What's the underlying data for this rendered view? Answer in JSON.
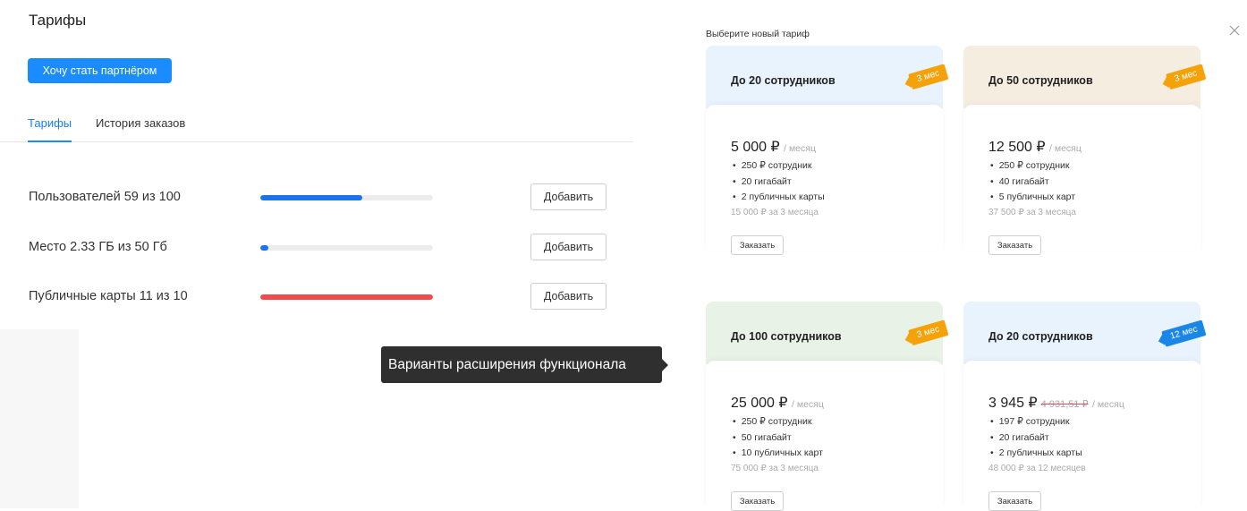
{
  "page": {
    "title": "Тарифы",
    "partner_button": "Хочу стать партнёром",
    "tabs": [
      {
        "label": "Тарифы",
        "active": true
      },
      {
        "label": "История заказов",
        "active": false
      }
    ],
    "tooltip": "Варианты расширения функционала"
  },
  "usage": [
    {
      "label": "Пользователей 59 из 100",
      "fill_fraction": 0.59,
      "color": "#1a73e8",
      "button": "Добавить"
    },
    {
      "label": "Место 2.33 ГБ из 50 Гб",
      "fill_fraction": 0.0466,
      "color": "#1a73e8",
      "button": "Добавить"
    },
    {
      "label": "Публичные карты 11 из 10",
      "fill_fraction": 1.0,
      "color": "#f24b4b",
      "button": "Добавить"
    }
  ],
  "plans_panel": {
    "title": "Выберите новый тариф",
    "close_icon": "close-icon",
    "plans": [
      {
        "name": "До 20 сотрудников",
        "badge": "3 мес",
        "badge_color": "#f5a20a",
        "header_color": "#e8f3fd",
        "price": "5 000 ₽",
        "per": "/ месяц",
        "old_price": "",
        "features": [
          "250 ₽ сотрудник",
          "20 гигабайт",
          "2 публичных карты"
        ],
        "total": "15 000 ₽ за 3 месяца",
        "order": "Заказать"
      },
      {
        "name": "До 50 сотрудников",
        "badge": "3 мес",
        "badge_color": "#f5a20a",
        "header_color": "#f6ede1",
        "price": "12 500 ₽",
        "per": "/ месяц",
        "old_price": "",
        "features": [
          "250 ₽ сотрудник",
          "40 гигабайт",
          "5 публичных карт"
        ],
        "total": "37 500 ₽ за 3 месяца",
        "order": "Заказать"
      },
      {
        "name": "До 100 сотрудников",
        "badge": "3 мес",
        "badge_color": "#f5a20a",
        "header_color": "#e9f2e7",
        "price": "25 000 ₽",
        "per": "/ месяц",
        "old_price": "",
        "features": [
          "250 ₽ сотрудник",
          "50 гигабайт",
          "10 публичных карт"
        ],
        "total": "75 000 ₽ за 3 месяца",
        "order": "Заказать"
      },
      {
        "name": "До 20 сотрудников",
        "badge": "12 мес",
        "badge_color": "#1a86e8",
        "header_color": "#e8f3fd",
        "price": "3 945 ₽",
        "per": "/ месяц",
        "old_price": "4 931,51 ₽",
        "features": [
          "197 ₽ сотрудник",
          "20 гигабайт",
          "2 публичных карты"
        ],
        "total": "48 000 ₽ за 12 месяцев",
        "order": "Заказать"
      }
    ]
  }
}
